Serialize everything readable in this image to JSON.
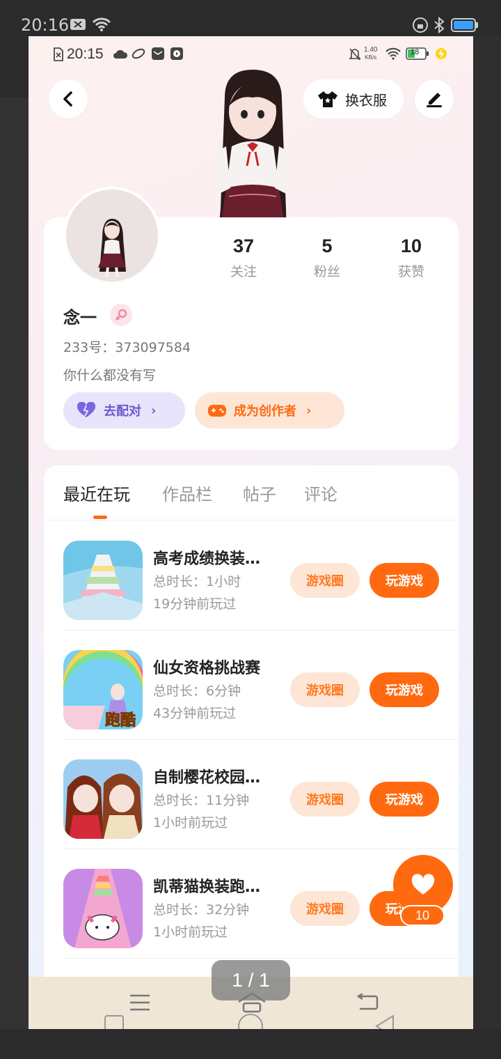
{
  "outer_status": {
    "time": "20:16"
  },
  "inner_status": {
    "time": "20:15",
    "net_speed": "1.40",
    "net_unit": "KB/s",
    "battery": "18"
  },
  "header": {
    "change_outfit_label": "换衣服"
  },
  "profile": {
    "stats": [
      {
        "value": "37",
        "label": "关注"
      },
      {
        "value": "5",
        "label": "粉丝"
      },
      {
        "value": "10",
        "label": "获赞"
      }
    ],
    "name": "念一",
    "uid": "233号：373097584",
    "bio": "你什么都没有写",
    "match_label": "去配对",
    "creator_label": "成为创作者"
  },
  "tabs": [
    {
      "label": "最近在玩",
      "active": true
    },
    {
      "label": "作品栏",
      "active": false
    },
    {
      "label": "帖子",
      "active": false
    },
    {
      "label": "评论",
      "active": false
    }
  ],
  "games": [
    {
      "title": "高考成绩换装…",
      "duration": "总时长：1小时",
      "last_played": "19分钟前玩过",
      "thumb_badge": ""
    },
    {
      "title": "仙女资格挑战赛",
      "duration": "总时长：6分钟",
      "last_played": "43分钟前玩过",
      "thumb_badge": "跑酷"
    },
    {
      "title": "自制樱花校园…",
      "duration": "总时长：11分钟",
      "last_played": "1小时前玩过",
      "thumb_badge": ""
    },
    {
      "title": "凯蒂猫换装跑…",
      "duration": "总时长：32分钟",
      "last_played": "1小时前玩过",
      "thumb_badge": ""
    }
  ],
  "buttons": {
    "circle_label": "游戏圈",
    "play_label": "玩游戏"
  },
  "fab": {
    "count": "10"
  },
  "pager": "1 / 1",
  "colors": {
    "accent": "#ff6a10",
    "accent_light": "#fde6d6",
    "match_bg": "#e8e4fb",
    "match_fg": "#6a5acd"
  }
}
